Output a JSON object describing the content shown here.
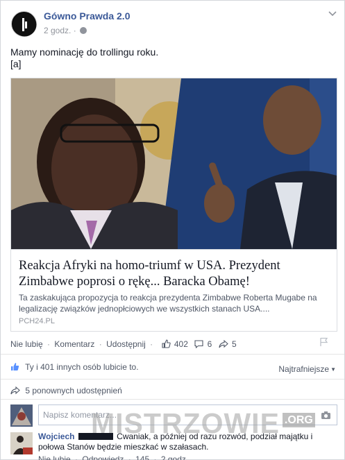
{
  "post": {
    "page_name": "Gówno Prawda 2.0",
    "time": "2 godz.",
    "dot": "·",
    "text_line1": "Mamy nominację do trollingu roku.",
    "text_line2": "[a]"
  },
  "link": {
    "title": "Reakcja Afryki na homo-triumf w USA. Prezydent Zimbabwe poprosi o rękę... Baracka Obamę!",
    "description": "Ta zaskakująca propozycja to reakcja prezydenta Zimbabwe Roberta Mugabe na legalizację związków jednopłciowych we wszystkich stanach USA....",
    "domain": "PCH24.PL"
  },
  "actions": {
    "unlike": "Nie lubię",
    "comment": "Komentarz",
    "share": "Udostępnij",
    "sep": "·",
    "likes_count": "402",
    "comments_count": "6",
    "shares_count": "5"
  },
  "likes_summary": "Ty i 401 innych osób lubicie to.",
  "sort_label": "Najtrafniejsze",
  "shares_summary": "5 ponownych udostępnień",
  "comment_input": {
    "placeholder": "Napisz komentarz..."
  },
  "watermark": {
    "text": "MISTRZOWIE",
    "suffix": ".ORG"
  },
  "comment": {
    "author": "Wojciech",
    "text": "Cwaniak, a później od razu rozwód, podział majątku i połowa Stanów będzie mieszkać w szałasach.",
    "actions": {
      "unlike": "Nie lubię",
      "reply": "Odpowiedz",
      "likes": "145",
      "time": "2 godz."
    }
  },
  "icons": {
    "avatar": "page-logo-icon",
    "globe": "globe-icon",
    "chevron": "chevron-down-icon",
    "like": "thumbs-up-icon",
    "comment": "comment-bubble-icon",
    "share": "share-arrow-icon",
    "flag": "flag-icon",
    "camera": "camera-icon"
  },
  "colors": {
    "link_blue": "#3b5998",
    "meta_gray": "#90949c"
  }
}
